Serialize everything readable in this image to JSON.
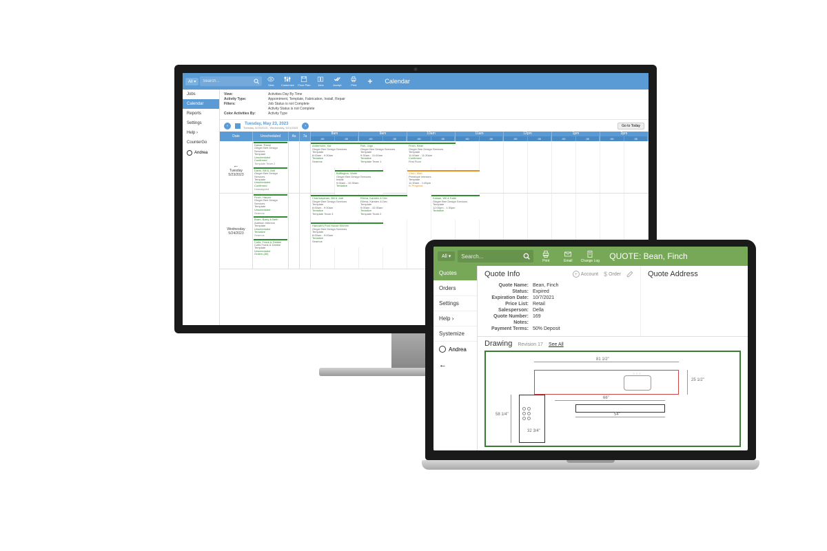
{
  "calendar": {
    "topbar": {
      "all": "All",
      "search_placeholder": "Search...",
      "icons": [
        {
          "name": "view-icon",
          "label": "View"
        },
        {
          "name": "customize-icon",
          "label": "Customize"
        },
        {
          "name": "floor-plan-icon",
          "label": "Floor Plan"
        },
        {
          "name": "jobs-icon",
          "label": "Jobs"
        },
        {
          "name": "accept-icon",
          "label": "Accept"
        },
        {
          "name": "print-icon",
          "label": "Print"
        },
        {
          "name": "add-icon",
          "label": ""
        }
      ],
      "title": "Calendar"
    },
    "sidebar": {
      "items": [
        {
          "label": "Jobs"
        },
        {
          "label": "Calendar"
        },
        {
          "label": "Reports"
        },
        {
          "label": "Settings"
        },
        {
          "label": "Help"
        },
        {
          "label": "CounterGo"
        }
      ],
      "active_index": 1,
      "user": "Andrea"
    },
    "filters": {
      "view_label": "View:",
      "view_value": "Activities Day By Time",
      "activity_type_label": "Activity Type:",
      "activity_type_value": "Appointment, Template, Fabrication, Install, Repair",
      "filters_label": "Filters:",
      "filters_value_1": "Job Status is not Complete",
      "filters_value_2": "Activity Status is not Complete",
      "color_label": "Color Activities By:",
      "color_value": "Activity Type"
    },
    "datebar": {
      "date": "Tuesday, May 23, 2023",
      "range": "Tuesday, 5/23/2023 - Wednesday, 6/21/2023",
      "goto": "Go to Today"
    },
    "grid_header": {
      "date": "Date",
      "unscheduled": "Unscheduled",
      "early_cols": [
        "As",
        "7a"
      ],
      "hours": [
        "8am",
        "9am",
        "10am",
        "11am",
        "12pm",
        "1pm",
        "2pm"
      ],
      "subs": [
        ":00",
        ":30"
      ]
    },
    "days": [
      {
        "label_day": "Tuesday",
        "label_date": "5/23/2023",
        "show_arrow": true,
        "unscheduled": [
          {
            "title": "Dawar, Raoul",
            "sub": "Ginger Bee Design Services",
            "type": "Template",
            "status": "Unscheduled",
            "confirm": "Confirmed",
            "foot": "Template Team 2"
          },
          {
            "title": "Davis, Bill & Judi",
            "sub": "Ginger Bee Design Services",
            "type": "Template",
            "status": "Unscheduled",
            "confirm": "Confirmed",
            "foot": "Unassigned"
          }
        ],
        "events": [
          {
            "col": 0,
            "span": 2,
            "row": 0,
            "title": "Anderholm, Kai",
            "sub": "Ginger Bee Design Services",
            "type": "Template",
            "time": "8:00am - 9:30am",
            "status": "Tentative",
            "foot": "Seamus",
            "color": "green"
          },
          {
            "col": 2,
            "span": 2,
            "row": 0,
            "title": "Roh, Jugo",
            "sub": "Ginger Bee Design Services",
            "type": "Template",
            "time": "9:30am - 11:00am",
            "status": "Tentative",
            "foot": "Template Team 1",
            "color": "green"
          },
          {
            "col": 4,
            "span": 2,
            "row": 0,
            "title": "Finch, Bean",
            "sub": "Ginger Bee Design Services",
            "type": "Template",
            "time": "11:00am - 11:30am",
            "status": "Confirmed",
            "foot": "First Floor",
            "color": "green"
          },
          {
            "col": 1,
            "span": 2,
            "row": 1,
            "title": "Buffington, Wolfe",
            "sub": "Ginger Bee Design Services",
            "type": "Install",
            "time": "9:00am - 10:30am",
            "status": "Tentative",
            "foot": "",
            "color": "green"
          },
          {
            "col": 4,
            "span": 3,
            "row": 1,
            "title": "Chen, Matt",
            "sub": "Penelope Interiors",
            "type": "Template",
            "time": "11:30am - 1:45pm",
            "status": "In Progress",
            "foot": "",
            "color": "orange"
          }
        ]
      },
      {
        "label_day": "Wednesday",
        "label_date": "5/24/2023",
        "show_arrow": false,
        "unscheduled": [
          {
            "title": "Finch, Harper",
            "sub": "Ginger Bee Design Services",
            "type": "Template",
            "status": "Unscheduled",
            "confirm": "",
            "foot": "Seamus"
          },
          {
            "title": "Bram, Barry & Beth",
            "sub": "Addison Interiors",
            "type": "Template",
            "status": "Unscheduled",
            "confirm": "Tentative",
            "foot": "Seamus"
          },
          {
            "title": "Cutts, Frank & Debbie",
            "sub": "Cutts Frank & Debbie",
            "type": "Template",
            "status": "Unscheduled",
            "confirm": "Orders (All)",
            "foot": ""
          }
        ],
        "events": [
          {
            "col": 0,
            "span": 2,
            "row": 0,
            "title": "Charmayanan, Bill & Jodi",
            "sub": "Ginger Bee Design Services",
            "type": "Template",
            "time": "8:00am - 9:30am",
            "status": "Tentative",
            "foot": "Template Team 3",
            "color": "green"
          },
          {
            "col": 2,
            "span": 2,
            "row": 0,
            "title": "Ellena, Karsten & Dev",
            "sub": "Ellena, Karsten & Dev",
            "type": "Template",
            "time": "9:00am - 10:30am",
            "status": "Tentative",
            "foot": "Template Team 2",
            "color": "green"
          },
          {
            "col": 5,
            "span": 2,
            "row": 0,
            "title": "Kaisan, Wil & Katie",
            "sub": "Ginger Bee Design Services",
            "type": "Template",
            "time": "12:00pm - 1:30pm",
            "status": "Tentative",
            "foot": "",
            "color": "green"
          },
          {
            "col": 0,
            "span": 3,
            "row": 1,
            "title": "Hannah's Pool House Kitchen",
            "sub": "Ginger Bee Design Services",
            "type": "Template",
            "time": "8:00am - 9:00am",
            "status": "Tentative",
            "foot": "Seamus",
            "color": "green"
          }
        ]
      }
    ]
  },
  "quote": {
    "topbar": {
      "all": "All",
      "search_placeholder": "Search...",
      "icons": [
        {
          "name": "print-icon",
          "label": "Print"
        },
        {
          "name": "email-icon",
          "label": "Email"
        },
        {
          "name": "changelog-icon",
          "label": "Change Log"
        }
      ],
      "title_prefix": "QUOTE:",
      "title_name": "Bean, Finch"
    },
    "sidebar": {
      "items": [
        {
          "label": "Quotes"
        },
        {
          "label": "Orders"
        },
        {
          "label": "Settings"
        },
        {
          "label": "Help"
        },
        {
          "label": "Systemize"
        }
      ],
      "active_index": 0,
      "user": "Andrea"
    },
    "info_panel": {
      "title": "Quote Info",
      "actions": {
        "account": "Account",
        "order": "Order"
      },
      "rows": [
        {
          "label": "Quote Name:",
          "value": "Bean, Finch"
        },
        {
          "label": "Status:",
          "value": "Expired"
        },
        {
          "label": "Expiration Date:",
          "value": "10/7/2021"
        },
        {
          "label": "Price List:",
          "value": "Retail"
        },
        {
          "label": "Salesperson:",
          "value": "Della"
        },
        {
          "label": "Quote Number:",
          "value": "169"
        },
        {
          "label": "Notes:",
          "value": ""
        },
        {
          "label": "Payment Terms:",
          "value": "50% Deposit"
        }
      ]
    },
    "address_panel": {
      "title": "Quote Address"
    },
    "drawing": {
      "title": "Drawing",
      "revision": "Revision 17",
      "see_all": "See All",
      "dims": {
        "top": "81 1/2\"",
        "right": "25 1/2\"",
        "left": "58 1/4\"",
        "inner1": "66\"",
        "inner2": "54\"",
        "bottom_left": "32 3/4\""
      }
    }
  }
}
